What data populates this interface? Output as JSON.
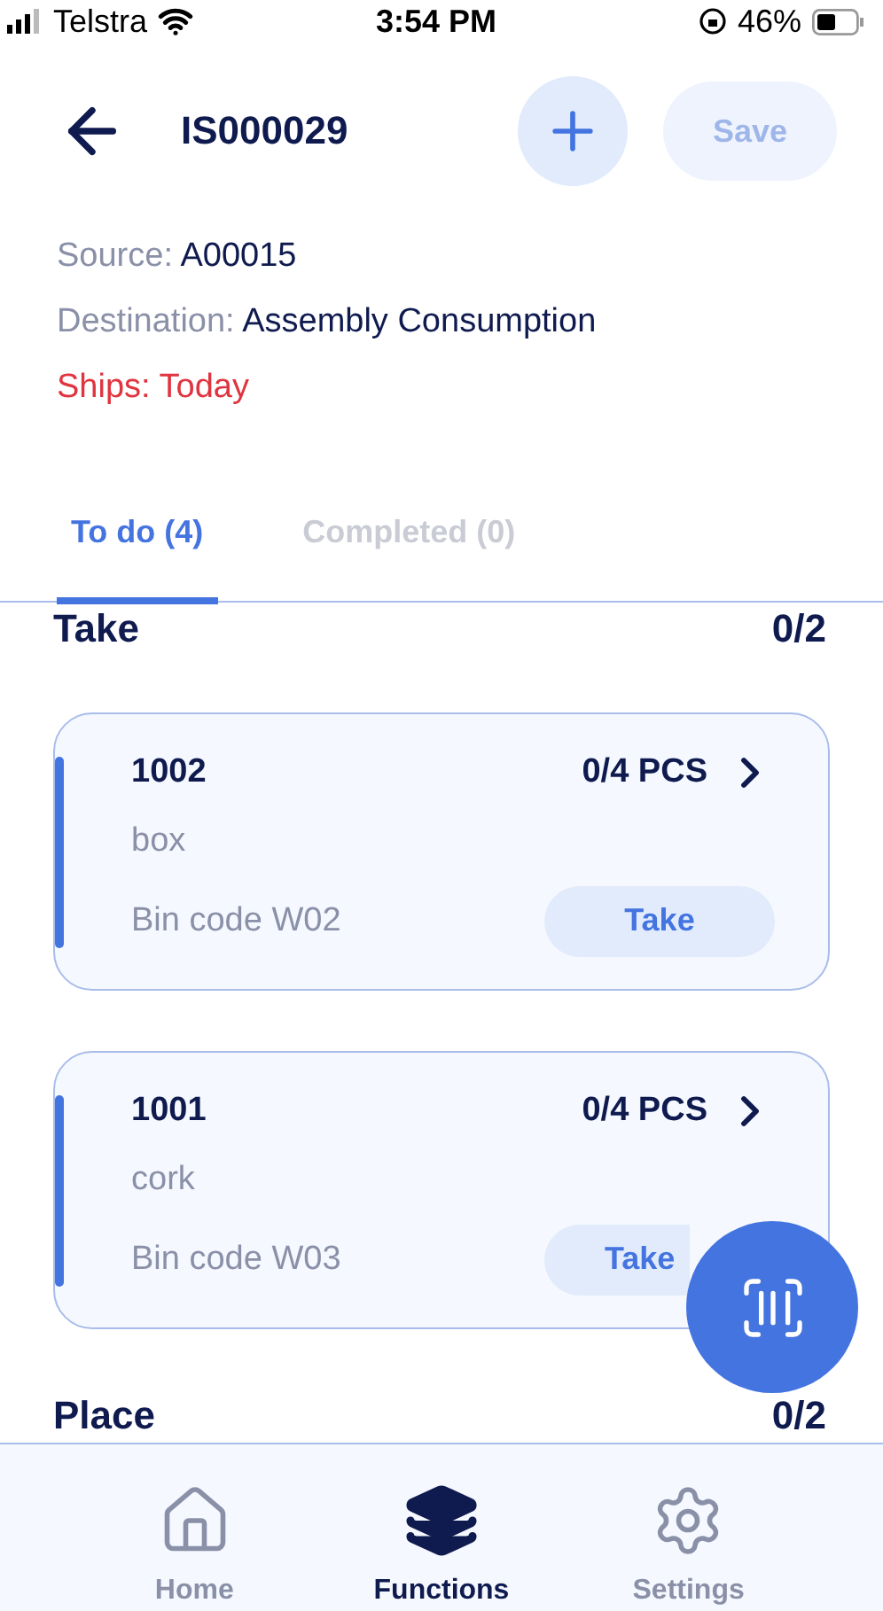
{
  "status_bar": {
    "carrier": "Telstra",
    "time": "3:54 PM",
    "battery": "46%"
  },
  "header": {
    "title": "IS000029",
    "save": {
      "label": "Save",
      "disabled": true
    }
  },
  "info": [
    {
      "label": "Source:",
      "value": "A00015",
      "kind": "normal"
    },
    {
      "label": "Destination:",
      "value": "Assembly Consumption",
      "kind": "normal"
    },
    {
      "label": "Ships:",
      "value": "Today",
      "kind": "alert"
    }
  ],
  "tabs": [
    {
      "label": "To do (4)",
      "selected": true
    },
    {
      "label": "Completed (0)",
      "selected": false
    }
  ],
  "sections": [
    {
      "title": "Take",
      "count": "0/2",
      "items": [
        {
          "code": "1002",
          "qty": "0/4 PCS",
          "name": "box",
          "bin": "Bin code W02",
          "action": "Take"
        },
        {
          "code": "1001",
          "qty": "0/4 PCS",
          "name": "cork",
          "bin": "Bin code W03",
          "action": "Take"
        }
      ]
    },
    {
      "title": "Place",
      "count": "0/2"
    }
  ],
  "nav": [
    {
      "label": "Home",
      "selected": false
    },
    {
      "label": "Functions",
      "selected": true
    },
    {
      "label": "Settings",
      "selected": false
    }
  ]
}
